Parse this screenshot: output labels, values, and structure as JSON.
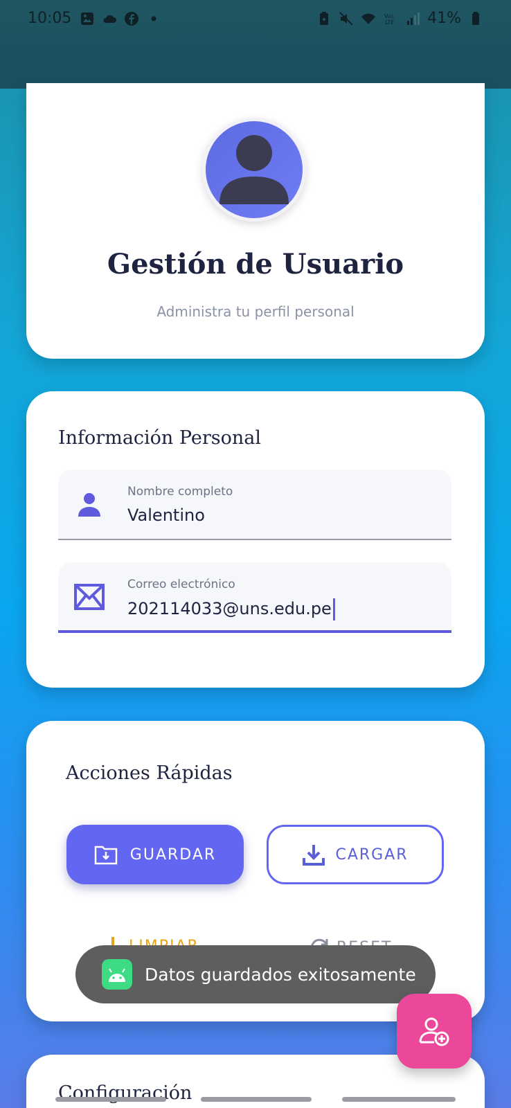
{
  "status_bar": {
    "time": "10:05",
    "battery": "41%",
    "icons_left": [
      "image-icon",
      "cloud-icon",
      "facebook-icon",
      "dot-icon"
    ],
    "icons_right": [
      "battery-saver-icon",
      "mute-icon",
      "wifi-icon",
      "volte-icon",
      "signal-icon",
      "battery-icon"
    ]
  },
  "header": {
    "title": "Gestión de Usuario",
    "subtitle": "Administra tu perfil personal"
  },
  "personal_info": {
    "section_title": "Información Personal",
    "name_field": {
      "label": "Nombre completo",
      "value": "Valentino"
    },
    "email_field": {
      "label": "Correo electrónico",
      "value": "202114033@uns.edu.pe"
    }
  },
  "quick_actions": {
    "section_title": "Acciones Rápidas",
    "save_label": "GUARDAR",
    "load_label": "CARGAR",
    "clear_label": "LIMPIAR",
    "reset_label": "RESET"
  },
  "toast": {
    "message": "Datos guardados exitosamente"
  },
  "config": {
    "section_title": "Configuración"
  },
  "colors": {
    "primary": "#6366f1",
    "fab": "#ec4899",
    "clear_accent": "#e8a317",
    "title_text": "#1e2340"
  }
}
